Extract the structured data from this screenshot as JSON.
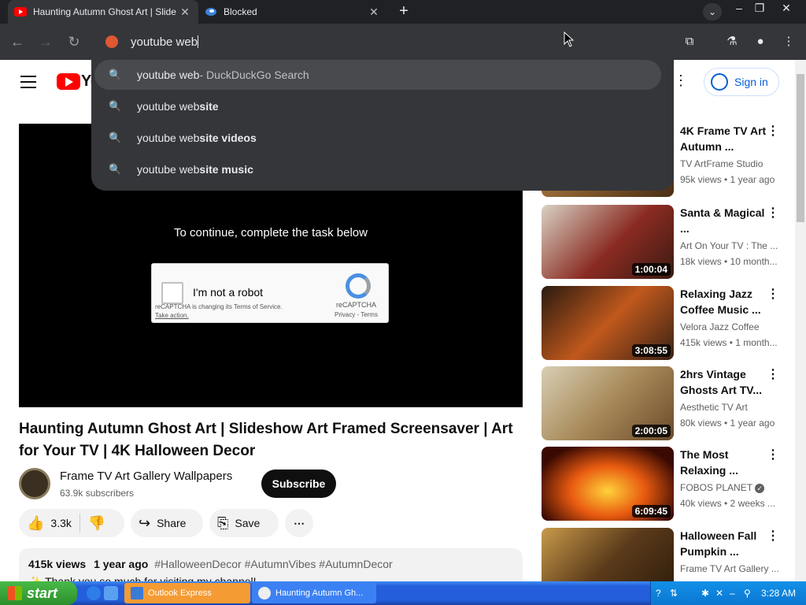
{
  "browser": {
    "tabs": [
      {
        "title": "Haunting Autumn Ghost Art | Slide",
        "active": true
      },
      {
        "title": "Blocked",
        "active": false
      }
    ],
    "new_tab_label": "+",
    "close_label": "✕",
    "omnibox": {
      "value": "youtube web",
      "suggestions": [
        {
          "prefix": "youtube web",
          "bold": "",
          "suffix": " - DuckDuckGo Search",
          "selected": true
        },
        {
          "prefix": "youtube web",
          "bold": "site",
          "suffix": "",
          "selected": false
        },
        {
          "prefix": "youtube web",
          "bold": "site videos",
          "suffix": "",
          "selected": false
        },
        {
          "prefix": "youtube web",
          "bold": "site music",
          "suffix": "",
          "selected": false
        }
      ]
    }
  },
  "youtube": {
    "logo_text": "Yo",
    "sign_in": "Sign in",
    "player_message": "To continue, complete the task below",
    "captcha": {
      "label": "I'm not a robot",
      "brand": "reCAPTCHA",
      "privacy_terms": "Privacy - Terms",
      "changing": "reCAPTCHA is changing its Terms of Service.",
      "take_action": "Take action."
    },
    "video_title": "Haunting Autumn Ghost Art | Slideshow Art Framed Screensaver | Art for Your TV | 4K Halloween Decor",
    "channel_name": "Frame TV Art Gallery Wallpapers",
    "subscribers": "63.9k subscribers",
    "subscribe": "Subscribe",
    "likes": "3.3k",
    "share": "Share",
    "save": "Save",
    "description": {
      "views": "415k views",
      "age": "1 year ago",
      "tags": "#HalloweenDecor #AutumnVibes #AutumnDecor",
      "first_line": "✨ Thank you so much for visiting my channel!"
    },
    "recommendations": [
      {
        "title": "4K Frame TV Art Autumn ...",
        "channel": "TV ArtFrame Studio",
        "views": "95k views • 1 year ago",
        "duration": "",
        "thumb": "#6b4a2a"
      },
      {
        "title": "Santa & Magical ...",
        "channel": "Art On Your TV : The ...",
        "views": "18k views • 10 month...",
        "duration": "1:00:04",
        "thumb": "#8a2b22"
      },
      {
        "title": "Relaxing Jazz Coffee Music ...",
        "channel": "Velora Jazz Coffee",
        "views": "415k views • 1 month...",
        "duration": "3:08:55",
        "thumb": "#7a3a14"
      },
      {
        "title": "2hrs Vintage Ghosts Art TV...",
        "channel": "Aesthetic TV Art",
        "views": "80k views • 1 year ago",
        "duration": "2:00:05",
        "thumb": "#9a8b6a"
      },
      {
        "title": "The Most Relaxing ...",
        "channel": "FOBOS PLANET",
        "views": "40k views • 2 weeks ...",
        "duration": "6:09:45",
        "thumb": "#c74a10"
      },
      {
        "title": "Halloween Fall Pumpkin ...",
        "channel": "Frame TV Art Gallery ...",
        "views": "",
        "duration": "",
        "thumb": "#5a3a1a"
      }
    ]
  },
  "taskbar": {
    "start": "start",
    "tasks": [
      {
        "label": "Outlook Express"
      },
      {
        "label": "Haunting Autumn Gh..."
      }
    ],
    "time": "3:28 AM"
  }
}
